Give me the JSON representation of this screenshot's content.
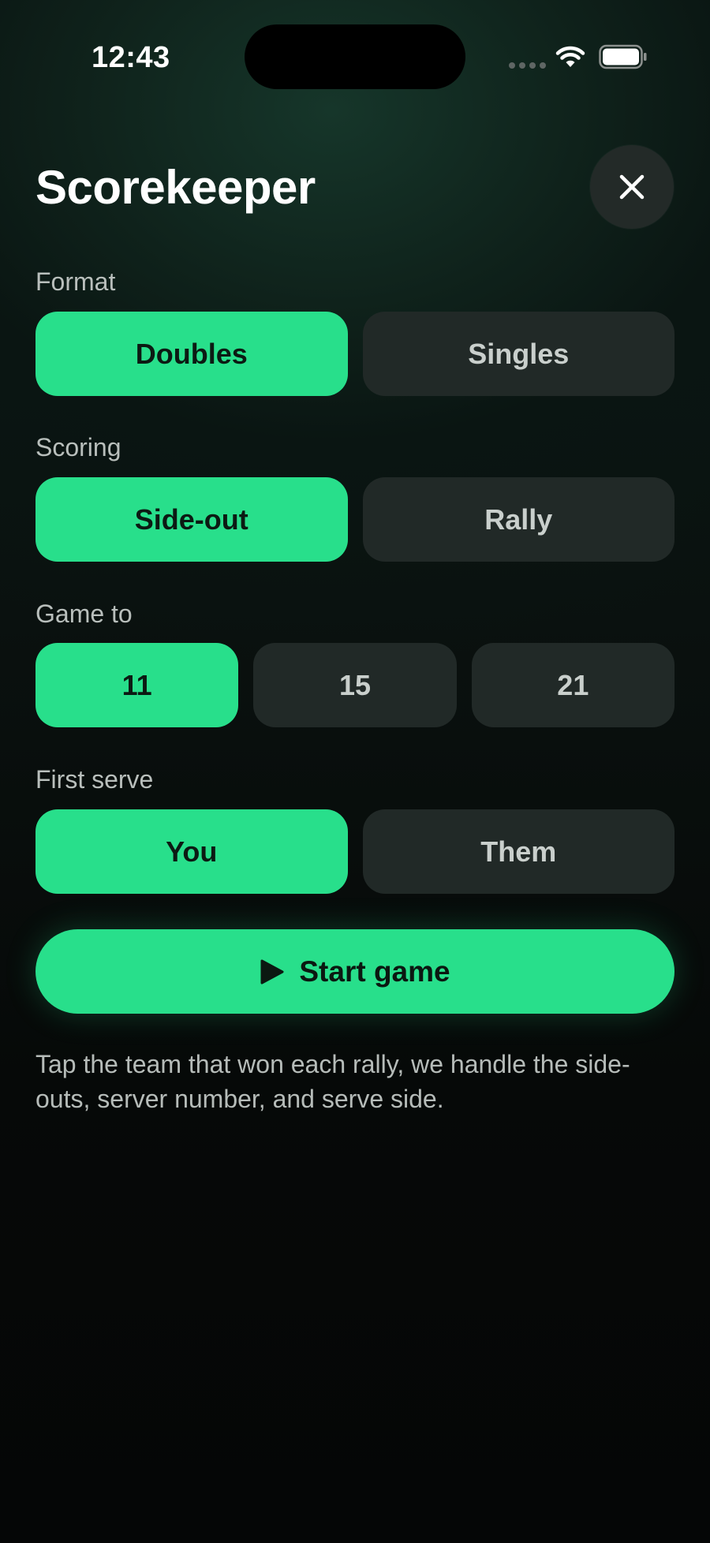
{
  "status_bar": {
    "time": "12:43"
  },
  "header": {
    "title": "Scorekeeper",
    "close_icon": "close-icon"
  },
  "format": {
    "label": "Format",
    "options": [
      "Doubles",
      "Singles"
    ],
    "selected": "Doubles"
  },
  "scoring": {
    "label": "Scoring",
    "options": [
      "Side-out",
      "Rally"
    ],
    "selected": "Side-out"
  },
  "game_to": {
    "label": "Game to",
    "options": [
      "11",
      "15",
      "21"
    ],
    "selected": "11"
  },
  "first_serve": {
    "label": "First serve",
    "options": [
      "You",
      "Them"
    ],
    "selected": "You"
  },
  "start": {
    "label": "Start game",
    "icon": "play-icon"
  },
  "helper_text": "Tap the team that won each rally, we handle the side-outs, server number, and serve side.",
  "colors": {
    "accent": "#28df8b",
    "inactive_button": "#212927",
    "background": "#050707"
  }
}
